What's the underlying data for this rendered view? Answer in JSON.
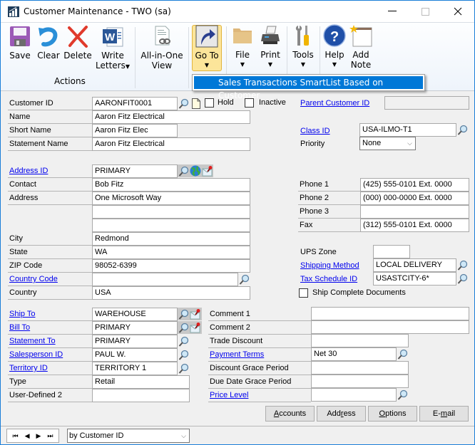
{
  "window": {
    "title": "Customer Maintenance  -  TWO (sa)",
    "controls": {
      "minimize": "—",
      "maximize": "☐",
      "close": "✕"
    }
  },
  "ribbon": {
    "actions_group": "Actions",
    "buttons": {
      "save": "Save",
      "clear": "Clear",
      "delete": "Delete",
      "write_letters_1": "Write",
      "write_letters_2": "Letters",
      "all_in_one_1": "All-in-One",
      "all_in_one_2": "View",
      "goto": "Go To",
      "file": "File",
      "print": "Print",
      "tools": "Tools",
      "help": "Help",
      "add_note_1": "Add",
      "add_note_2": "Note"
    },
    "goto_menu": [
      "Sales Transactions SmartList Based on Customer"
    ]
  },
  "form": {
    "customer_id": {
      "label": "Customer ID",
      "value": "AARONFIT0001"
    },
    "hold": {
      "label": "Hold",
      "checked": false
    },
    "inactive": {
      "label": "Inactive",
      "checked": false
    },
    "parent_customer_id": {
      "label": "Parent Customer ID",
      "value": ""
    },
    "name": {
      "label": "Name",
      "value": "Aaron Fitz Electrical"
    },
    "short_name": {
      "label": "Short Name",
      "value": "Aaron Fitz Elec"
    },
    "class_id": {
      "label": "Class ID",
      "value": "USA-ILMO-T1"
    },
    "statement_name": {
      "label": "Statement Name",
      "value": "Aaron Fitz Electrical"
    },
    "priority": {
      "label": "Priority",
      "value": "None"
    },
    "address_id": {
      "label": "Address ID",
      "value": "PRIMARY"
    },
    "contact": {
      "label": "Contact",
      "value": "Bob Fitz"
    },
    "address": {
      "label": "Address",
      "line1": "One Microsoft Way",
      "line2": "",
      "line3": ""
    },
    "city": {
      "label": "City",
      "value": "Redmond"
    },
    "state": {
      "label": "State",
      "value": "WA"
    },
    "zip": {
      "label": "ZIP Code",
      "value": "98052-6399"
    },
    "country_code": {
      "label": "Country Code",
      "value": ""
    },
    "country": {
      "label": "Country",
      "value": "USA"
    },
    "phone1": {
      "label": "Phone 1",
      "value": "(425) 555-0101  Ext. 0000"
    },
    "phone2": {
      "label": "Phone 2",
      "value": "(000) 000-0000  Ext. 0000"
    },
    "phone3": {
      "label": "Phone 3",
      "value": ""
    },
    "fax": {
      "label": "Fax",
      "value": "(312) 555-0101  Ext. 0000"
    },
    "ups_zone": {
      "label": "UPS Zone",
      "value": ""
    },
    "shipping_method": {
      "label": "Shipping Method",
      "value": "LOCAL DELIVERY"
    },
    "tax_schedule_id": {
      "label": "Tax Schedule ID",
      "value": "USASTCITY-6*"
    },
    "ship_complete": {
      "label": "Ship Complete Documents",
      "checked": false
    },
    "ship_to": {
      "label": "Ship To",
      "value": "WAREHOUSE"
    },
    "bill_to": {
      "label": "Bill To",
      "value": "PRIMARY"
    },
    "statement_to": {
      "label": "Statement To",
      "value": "PRIMARY"
    },
    "salesperson_id": {
      "label": "Salesperson ID",
      "value": "PAUL W."
    },
    "territory_id": {
      "label": "Territory ID",
      "value": "TERRITORY 1"
    },
    "type": {
      "label": "Type",
      "value": "Retail"
    },
    "user_defined_2": {
      "label": "User-Defined 2",
      "value": ""
    },
    "comment1": {
      "label": "Comment 1",
      "value": ""
    },
    "comment2": {
      "label": "Comment 2",
      "value": ""
    },
    "trade_discount": {
      "label": "Trade Discount",
      "value": ""
    },
    "payment_terms": {
      "label": "Payment Terms",
      "value": "Net 30"
    },
    "discount_grace": {
      "label": "Discount Grace Period",
      "value": ""
    },
    "due_date_grace": {
      "label": "Due Date Grace Period",
      "value": ""
    },
    "price_level": {
      "label": "Price Level",
      "value": ""
    }
  },
  "bottom_buttons": {
    "accounts": {
      "hotkey": "A",
      "rest": "ccounts"
    },
    "address": {
      "pre": "Add",
      "hotkey": "r",
      "rest": "ess"
    },
    "options": {
      "hotkey": "O",
      "rest": "ptions"
    },
    "email": {
      "pre": "E-",
      "hotkey": "m",
      "rest": "ail"
    }
  },
  "statusbar": {
    "nav": {
      "first": "first-record",
      "prev": "previous-record",
      "next": "next-record",
      "last": "last-record"
    },
    "sort_by": "by Customer ID"
  }
}
